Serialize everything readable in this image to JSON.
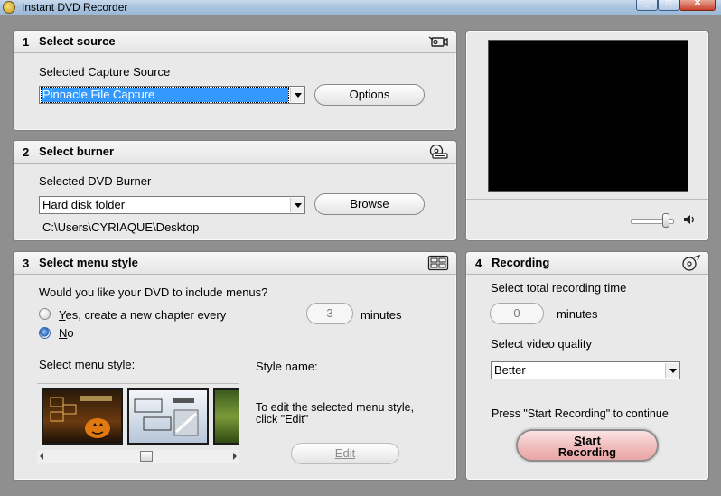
{
  "window": {
    "title": "Instant DVD Recorder"
  },
  "source": {
    "number": "1",
    "title": "Select source",
    "capture_label": "Selected Capture Source",
    "capture_value": "Pinnacle File Capture",
    "options_button": "Options"
  },
  "burner": {
    "number": "2",
    "title": "Select burner",
    "burner_label": "Selected DVD Burner",
    "burner_value": "Hard disk folder",
    "browse_button": "Browse",
    "path": "C:\\Users\\CYRIAQUE\\Desktop"
  },
  "menu": {
    "number": "3",
    "title": "Select menu style",
    "question": "Would you like your DVD to include menus?",
    "option_yes": "Yes, create a new chapter every",
    "option_no": "No",
    "selected_option": "No",
    "chapter_minutes": "3",
    "minutes_label": "minutes",
    "menu_style_label": "Select menu style:",
    "style_name_label": "Style name:",
    "edit_hint": "To edit the selected menu style, click \"Edit\"",
    "edit_button": "Edit"
  },
  "recording": {
    "number": "4",
    "title": "Recording",
    "time_label": "Select total recording time",
    "time_value": "0",
    "minutes_label": "minutes",
    "quality_label": "Select video quality",
    "quality_value": "Better",
    "prompt": "Press \"Start Recording\" to continue",
    "start_line1": "Start",
    "start_line2": "Recording"
  },
  "preview": {
    "volume": 0.9
  }
}
